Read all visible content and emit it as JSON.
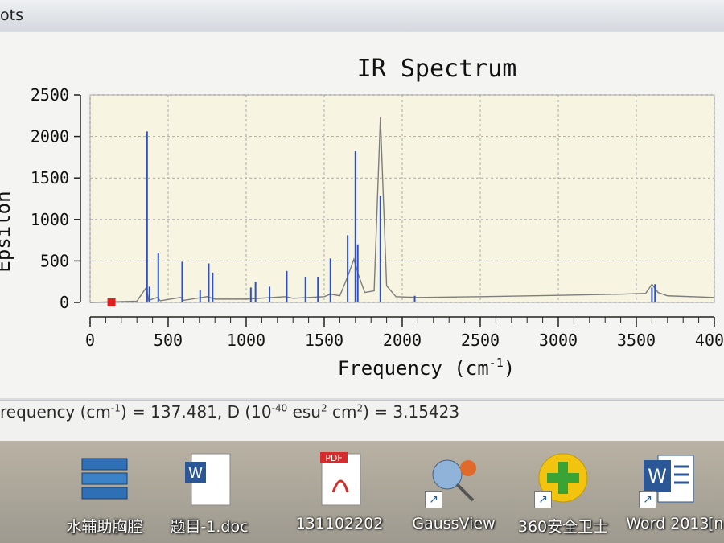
{
  "window": {
    "title": "ots"
  },
  "chart_data": {
    "type": "line",
    "title": "IR Spectrum",
    "xlabel": "Frequency",
    "xlabel_unit": "cm",
    "xlabel_unit_exp": "-1",
    "ylabel": "Epsilon",
    "xlim": [
      0,
      4000
    ],
    "ylim": [
      0,
      2500
    ],
    "xticks": [
      "0",
      "500",
      "1000",
      "1500",
      "2000",
      "2500",
      "3000",
      "3500",
      "4000"
    ],
    "yticks": [
      "0",
      "500",
      "1000",
      "1500",
      "2000",
      "2500"
    ],
    "grid": true,
    "colors": {
      "stick": "#2b50c8",
      "envelope": "#7d7d7d",
      "marker": "#e02020",
      "background": "#f7f5e1"
    },
    "sticks": [
      {
        "x": 137,
        "y": 15
      },
      {
        "x": 365,
        "y": 2060
      },
      {
        "x": 380,
        "y": 190
      },
      {
        "x": 437,
        "y": 600
      },
      {
        "x": 590,
        "y": 490
      },
      {
        "x": 705,
        "y": 150
      },
      {
        "x": 760,
        "y": 470
      },
      {
        "x": 785,
        "y": 360
      },
      {
        "x": 1030,
        "y": 180
      },
      {
        "x": 1060,
        "y": 250
      },
      {
        "x": 1150,
        "y": 190
      },
      {
        "x": 1260,
        "y": 380
      },
      {
        "x": 1380,
        "y": 310
      },
      {
        "x": 1460,
        "y": 310
      },
      {
        "x": 1540,
        "y": 530
      },
      {
        "x": 1650,
        "y": 810
      },
      {
        "x": 1700,
        "y": 1820
      },
      {
        "x": 1715,
        "y": 700
      },
      {
        "x": 1860,
        "y": 1280
      },
      {
        "x": 2080,
        "y": 80
      },
      {
        "x": 3600,
        "y": 180
      },
      {
        "x": 3620,
        "y": 220
      }
    ],
    "envelope": [
      [
        0,
        0
      ],
      [
        300,
        15
      ],
      [
        360,
        180
      ],
      [
        375,
        25
      ],
      [
        430,
        60
      ],
      [
        450,
        20
      ],
      [
        580,
        60
      ],
      [
        600,
        25
      ],
      [
        750,
        70
      ],
      [
        800,
        40
      ],
      [
        1000,
        40
      ],
      [
        1250,
        70
      ],
      [
        1300,
        50
      ],
      [
        1500,
        70
      ],
      [
        1540,
        100
      ],
      [
        1600,
        80
      ],
      [
        1650,
        310
      ],
      [
        1690,
        520
      ],
      [
        1720,
        330
      ],
      [
        1760,
        120
      ],
      [
        1820,
        140
      ],
      [
        1860,
        2230
      ],
      [
        1900,
        200
      ],
      [
        1960,
        70
      ],
      [
        2100,
        60
      ],
      [
        2500,
        70
      ],
      [
        3000,
        85
      ],
      [
        3400,
        100
      ],
      [
        3560,
        110
      ],
      [
        3600,
        220
      ],
      [
        3640,
        120
      ],
      [
        3700,
        80
      ],
      [
        4000,
        60
      ]
    ],
    "marker_x": 137
  },
  "status": {
    "prefix": "requency (cm",
    "exp1": "-1",
    "mid": ") = 137.481, D (10",
    "exp2": "-40",
    "mid2": " esu",
    "exp3": "2",
    "mid3": " cm",
    "exp4": "2",
    "suffix": ") = 3.15423"
  },
  "taskbar": {
    "items": [
      {
        "label": "水辅助胸腔",
        "icon": "database-icon"
      },
      {
        "label": "题目-1.doc",
        "icon": "word-doc-icon"
      },
      {
        "label": "131102202",
        "icon": "pdf-icon",
        "badge": "PDF"
      },
      {
        "label": "GaussView",
        "icon": "gaussview-icon"
      },
      {
        "label": "360安全卫士",
        "icon": "360-safe-icon"
      },
      {
        "label": "Word 2013",
        "icon": "word-2013-icon"
      },
      {
        "label": "[n",
        "icon": "partial-icon"
      }
    ]
  }
}
